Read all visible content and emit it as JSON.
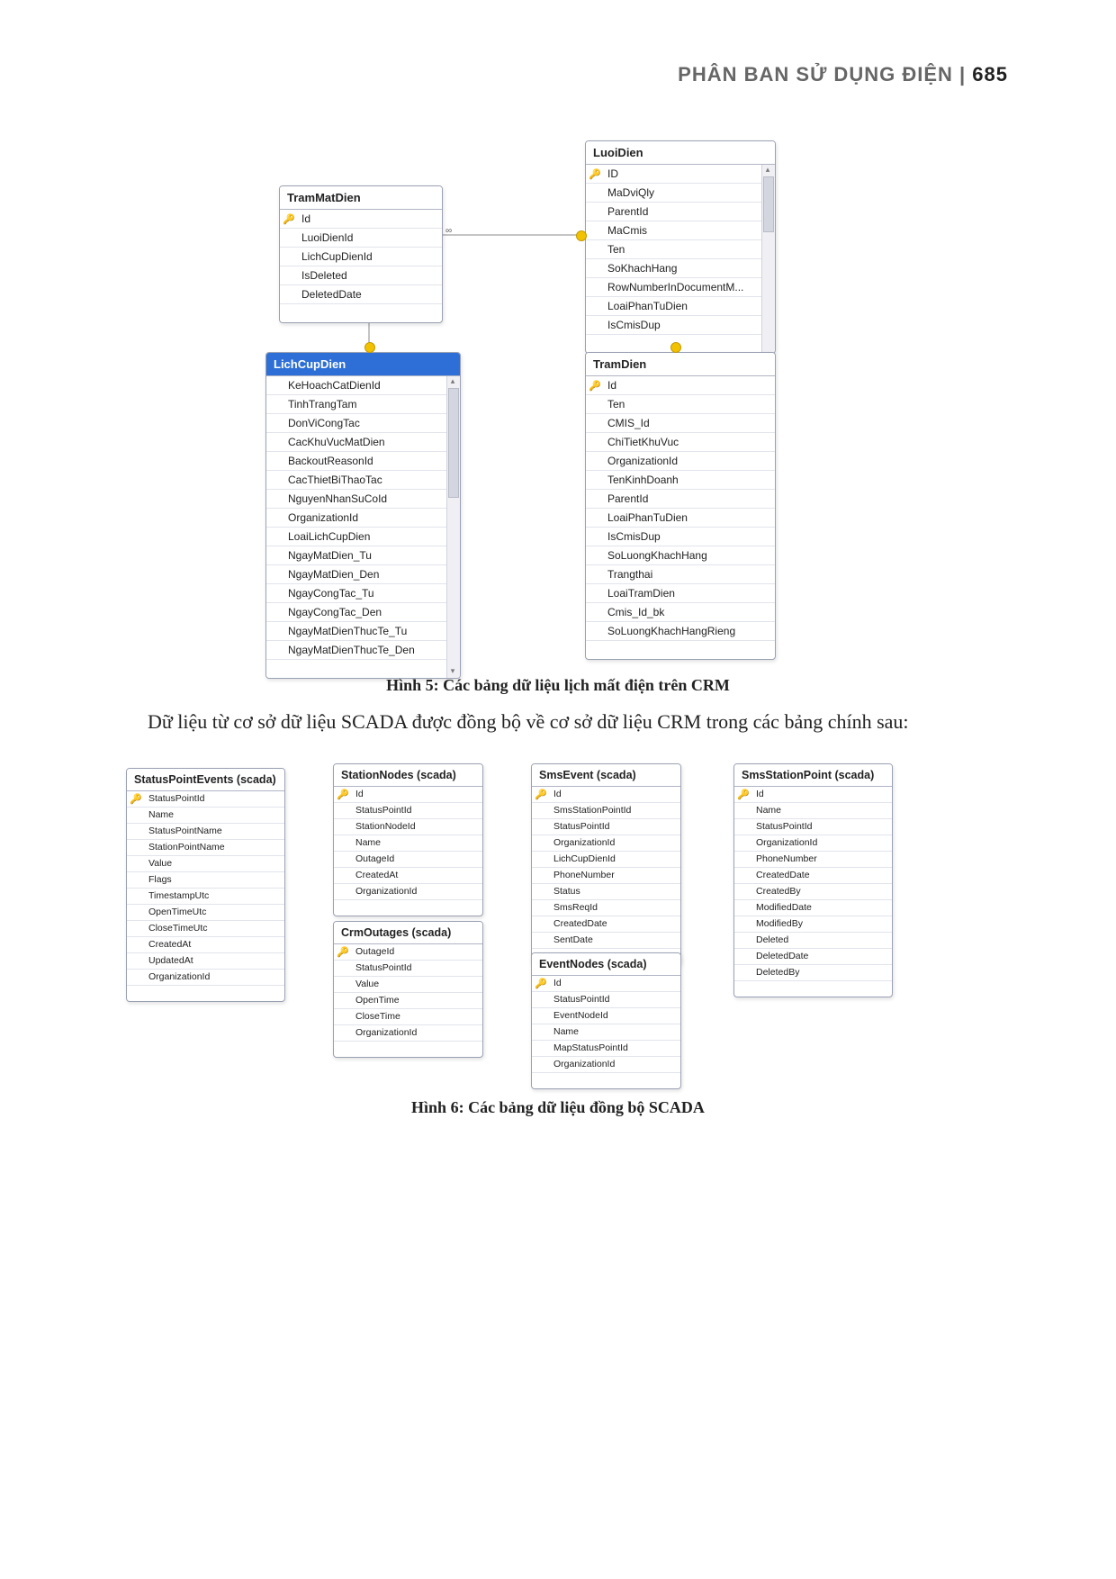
{
  "header": {
    "section": "PHÂN BAN SỬ DỤNG ĐIỆN",
    "sep": " | ",
    "page": "685"
  },
  "fig5_caption": "Hình 5: Các bảng dữ liệu lịch mất điện trên CRM",
  "paragraph": "Dữ liệu từ cơ sở dữ liệu SCADA được đồng bộ về cơ sở dữ liệu CRM trong các bảng chính sau:",
  "fig6_caption": "Hình 6: Các bảng dữ liệu đồng bộ SCADA",
  "fig5": {
    "TramMatDien": {
      "title": "TramMatDien",
      "fields": [
        {
          "key": true,
          "name": "Id"
        },
        {
          "key": false,
          "name": "LuoiDienId"
        },
        {
          "key": false,
          "name": "LichCupDienId"
        },
        {
          "key": false,
          "name": "IsDeleted"
        },
        {
          "key": false,
          "name": "DeletedDate"
        }
      ]
    },
    "LuoiDien": {
      "title": "LuoiDien",
      "fields": [
        {
          "key": true,
          "name": "ID"
        },
        {
          "key": false,
          "name": "MaDviQly"
        },
        {
          "key": false,
          "name": "ParentId"
        },
        {
          "key": false,
          "name": "MaCmis"
        },
        {
          "key": false,
          "name": "Ten"
        },
        {
          "key": false,
          "name": "SoKhachHang"
        },
        {
          "key": false,
          "name": "RowNumberInDocumentM..."
        },
        {
          "key": false,
          "name": "LoaiPhanTuDien"
        },
        {
          "key": false,
          "name": "IsCmisDup"
        }
      ]
    },
    "LichCupDien": {
      "title": "LichCupDien",
      "fields": [
        {
          "key": false,
          "name": "KeHoachCatDienId"
        },
        {
          "key": false,
          "name": "TinhTrangTam"
        },
        {
          "key": false,
          "name": "DonViCongTac"
        },
        {
          "key": false,
          "name": "CacKhuVucMatDien"
        },
        {
          "key": false,
          "name": "BackoutReasonId"
        },
        {
          "key": false,
          "name": "CacThietBiThaoTac"
        },
        {
          "key": false,
          "name": "NguyenNhanSuCoId"
        },
        {
          "key": false,
          "name": "OrganizationId"
        },
        {
          "key": false,
          "name": "LoaiLichCupDien"
        },
        {
          "key": false,
          "name": "NgayMatDien_Tu"
        },
        {
          "key": false,
          "name": "NgayMatDien_Den"
        },
        {
          "key": false,
          "name": "NgayCongTac_Tu"
        },
        {
          "key": false,
          "name": "NgayCongTac_Den"
        },
        {
          "key": false,
          "name": "NgayMatDienThucTe_Tu"
        },
        {
          "key": false,
          "name": "NgayMatDienThucTe_Den"
        }
      ]
    },
    "TramDien": {
      "title": "TramDien",
      "fields": [
        {
          "key": true,
          "name": "Id"
        },
        {
          "key": false,
          "name": "Ten"
        },
        {
          "key": false,
          "name": "CMIS_Id"
        },
        {
          "key": false,
          "name": "ChiTietKhuVuc"
        },
        {
          "key": false,
          "name": "OrganizationId"
        },
        {
          "key": false,
          "name": "TenKinhDoanh"
        },
        {
          "key": false,
          "name": "ParentId"
        },
        {
          "key": false,
          "name": "LoaiPhanTuDien"
        },
        {
          "key": false,
          "name": "IsCmisDup"
        },
        {
          "key": false,
          "name": "SoLuongKhachHang"
        },
        {
          "key": false,
          "name": "Trangthai"
        },
        {
          "key": false,
          "name": "LoaiTramDien"
        },
        {
          "key": false,
          "name": "Cmis_Id_bk"
        },
        {
          "key": false,
          "name": "SoLuongKhachHangRieng"
        }
      ]
    }
  },
  "fig6": {
    "StatusPointEvents": {
      "title": "StatusPointEvents (scada)",
      "fields": [
        {
          "key": true,
          "name": "StatusPointId"
        },
        {
          "key": false,
          "name": "Name"
        },
        {
          "key": false,
          "name": "StatusPointName"
        },
        {
          "key": false,
          "name": "StationPointName"
        },
        {
          "key": false,
          "name": "Value"
        },
        {
          "key": false,
          "name": "Flags"
        },
        {
          "key": false,
          "name": "TimestampUtc"
        },
        {
          "key": false,
          "name": "OpenTimeUtc"
        },
        {
          "key": false,
          "name": "CloseTimeUtc"
        },
        {
          "key": false,
          "name": "CreatedAt"
        },
        {
          "key": false,
          "name": "UpdatedAt"
        },
        {
          "key": false,
          "name": "OrganizationId"
        }
      ]
    },
    "StationNodes": {
      "title": "StationNodes (scada)",
      "fields": [
        {
          "key": true,
          "name": "Id"
        },
        {
          "key": false,
          "name": "StatusPointId"
        },
        {
          "key": false,
          "name": "StationNodeId"
        },
        {
          "key": false,
          "name": "Name"
        },
        {
          "key": false,
          "name": "OutageId"
        },
        {
          "key": false,
          "name": "CreatedAt"
        },
        {
          "key": false,
          "name": "OrganizationId"
        }
      ]
    },
    "CrmOutages": {
      "title": "CrmOutages (scada)",
      "fields": [
        {
          "key": true,
          "name": "OutageId"
        },
        {
          "key": false,
          "name": "StatusPointId"
        },
        {
          "key": false,
          "name": "Value"
        },
        {
          "key": false,
          "name": "OpenTime"
        },
        {
          "key": false,
          "name": "CloseTime"
        },
        {
          "key": false,
          "name": "OrganizationId"
        }
      ]
    },
    "SmsEvent": {
      "title": "SmsEvent (scada)",
      "fields": [
        {
          "key": true,
          "name": "Id"
        },
        {
          "key": false,
          "name": "SmsStationPointId"
        },
        {
          "key": false,
          "name": "StatusPointId"
        },
        {
          "key": false,
          "name": "OrganizationId"
        },
        {
          "key": false,
          "name": "LichCupDienId"
        },
        {
          "key": false,
          "name": "PhoneNumber"
        },
        {
          "key": false,
          "name": "Status"
        },
        {
          "key": false,
          "name": "SmsReqId"
        },
        {
          "key": false,
          "name": "CreatedDate"
        },
        {
          "key": false,
          "name": "SentDate"
        }
      ]
    },
    "EventNodes": {
      "title": "EventNodes (scada)",
      "fields": [
        {
          "key": true,
          "name": "Id"
        },
        {
          "key": false,
          "name": "StatusPointId"
        },
        {
          "key": false,
          "name": "EventNodeId"
        },
        {
          "key": false,
          "name": "Name"
        },
        {
          "key": false,
          "name": "MapStatusPointId"
        },
        {
          "key": false,
          "name": "OrganizationId"
        }
      ]
    },
    "SmsStationPoint": {
      "title": "SmsStationPoint (scada)",
      "fields": [
        {
          "key": true,
          "name": "Id"
        },
        {
          "key": false,
          "name": "Name"
        },
        {
          "key": false,
          "name": "StatusPointId"
        },
        {
          "key": false,
          "name": "OrganizationId"
        },
        {
          "key": false,
          "name": "PhoneNumber"
        },
        {
          "key": false,
          "name": "CreatedDate"
        },
        {
          "key": false,
          "name": "CreatedBy"
        },
        {
          "key": false,
          "name": "ModifiedDate"
        },
        {
          "key": false,
          "name": "ModifiedBy"
        },
        {
          "key": false,
          "name": "Deleted"
        },
        {
          "key": false,
          "name": "DeletedDate"
        },
        {
          "key": false,
          "name": "DeletedBy"
        }
      ]
    }
  }
}
